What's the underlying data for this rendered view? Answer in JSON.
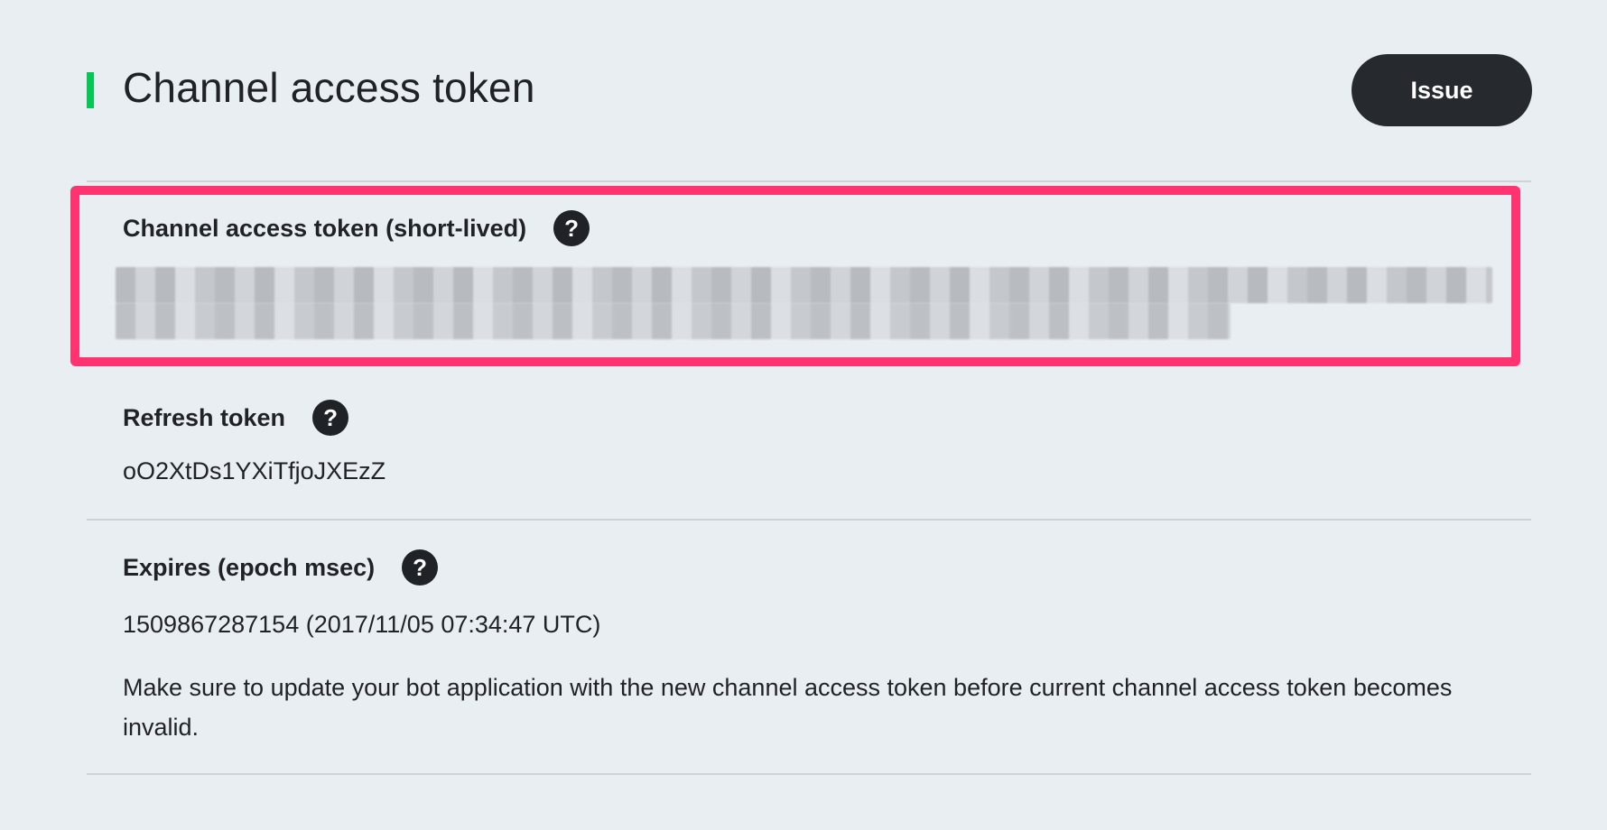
{
  "header": {
    "title": "Channel access token",
    "issue_button_label": "Issue",
    "accent_color": "#06c755"
  },
  "fields": {
    "short_lived": {
      "label": "Channel access token (short-lived)",
      "help_icon": "question-icon"
    },
    "refresh_token": {
      "label": "Refresh token",
      "value": "oO2XtDs1YXiTfjoJXEzZ",
      "help_icon": "question-icon"
    },
    "expires": {
      "label": "Expires (epoch msec)",
      "value": "1509867287154 (2017/11/05 07:34:47 UTC)",
      "help_icon": "question-icon",
      "note": "Make sure to update your bot application with the new channel access token before current channel access token becomes invalid."
    }
  },
  "colors": {
    "background": "#e9eef2",
    "highlight": "#ff3370",
    "button_bg": "#262a2f"
  }
}
